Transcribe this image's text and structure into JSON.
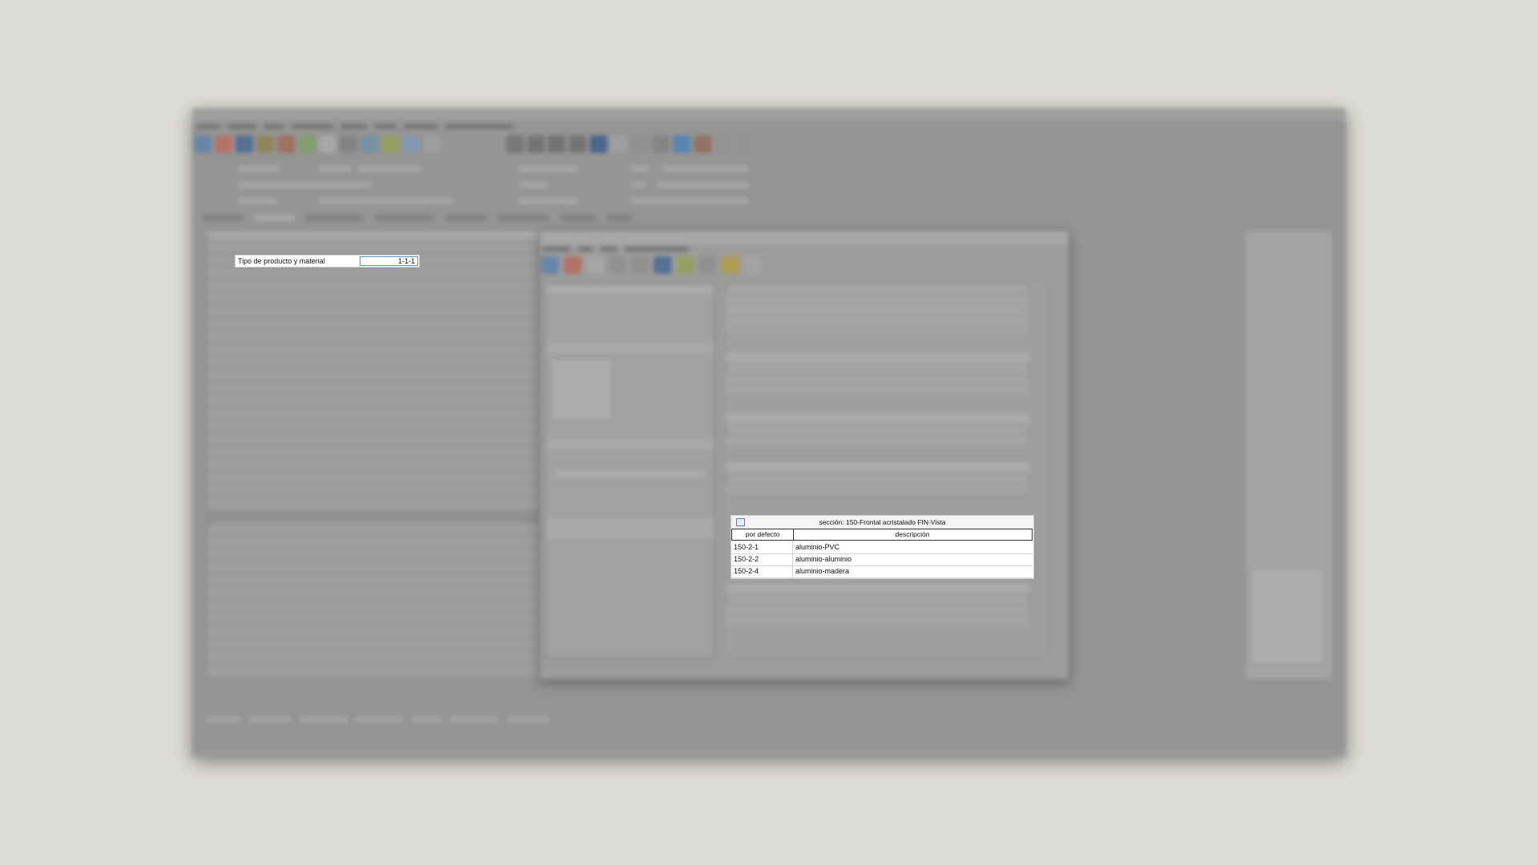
{
  "highlighted_field": {
    "label": "Tipo de producto y material",
    "value": "1-1-1"
  },
  "highlighted_section": {
    "title": "sección: 150-Frontal acristalado FIN-Vista",
    "col_default": "por defecto",
    "col_description": "descripción",
    "rows": [
      {
        "code": "150-2-1",
        "desc": "aluminio-PVC"
      },
      {
        "code": "150-2-2",
        "desc": "aluminio-aluminio"
      },
      {
        "code": "150-2-4",
        "desc": "aluminio-madera"
      }
    ]
  }
}
